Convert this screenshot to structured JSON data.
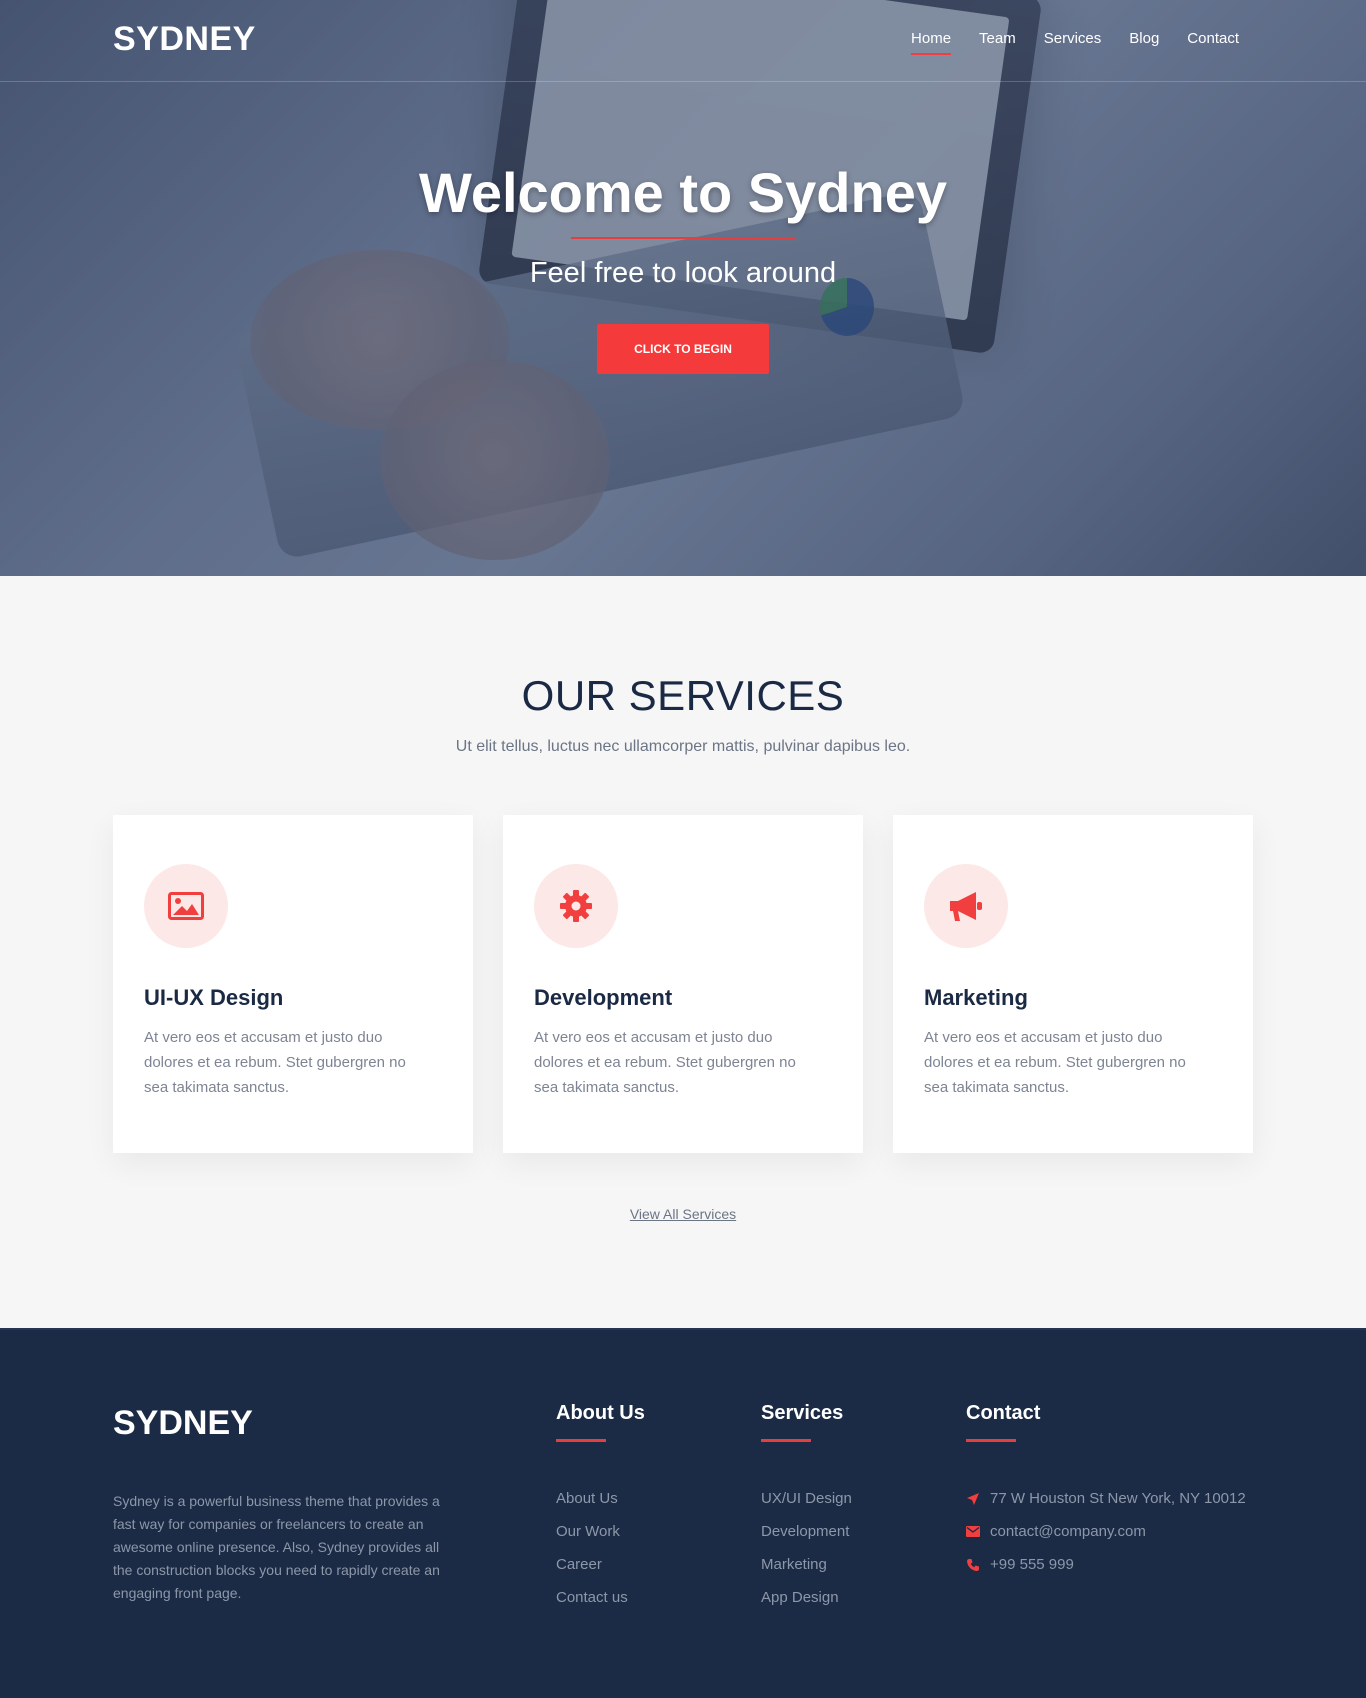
{
  "header": {
    "logo": "SYDNEY",
    "nav": [
      "Home",
      "Team",
      "Services",
      "Blog",
      "Contact"
    ],
    "active": "Home"
  },
  "hero": {
    "title": "Welcome to Sydney",
    "subtitle": "Feel free to look around",
    "cta": "CLICK TO BEGIN"
  },
  "services": {
    "title": "OUR SERVICES",
    "subtitle": "Ut elit tellus, luctus nec ullamcorper mattis, pulvinar dapibus leo.",
    "cards": [
      {
        "title": "UI-UX Design",
        "icon": "image-icon",
        "desc": "At vero eos et accusam et justo duo dolores et ea rebum. Stet gubergren no sea takimata sanctus."
      },
      {
        "title": "Development",
        "icon": "gear-icon",
        "desc": "At vero eos et accusam et justo duo dolores et ea rebum. Stet gubergren no sea takimata sanctus."
      },
      {
        "title": "Marketing",
        "icon": "megaphone-icon",
        "desc": "At vero eos et accusam et justo duo dolores et ea rebum. Stet gubergren no sea takimata sanctus."
      }
    ],
    "view_all": "View All Services"
  },
  "footer": {
    "logo": "SYDNEY",
    "about": "Sydney is a powerful business theme that provides a fast way for companies or freelancers to create an awesome online presence. Also, Sydney provides all the construction blocks you need to rapidly create an engaging front page.",
    "about_us": {
      "title": "About Us",
      "links": [
        "About Us",
        "Our Work",
        "Career",
        "Contact us"
      ]
    },
    "services": {
      "title": "Services",
      "links": [
        "UX/UI Design",
        "Development",
        "Marketing",
        "App Design"
      ]
    },
    "contact": {
      "title": "Contact",
      "address": "77 W Houston St New York, NY 10012",
      "email": "contact@company.com",
      "phone": "+99 555 999"
    }
  },
  "colors": {
    "accent": "#f43a3a",
    "navy": "#1b2b45"
  }
}
